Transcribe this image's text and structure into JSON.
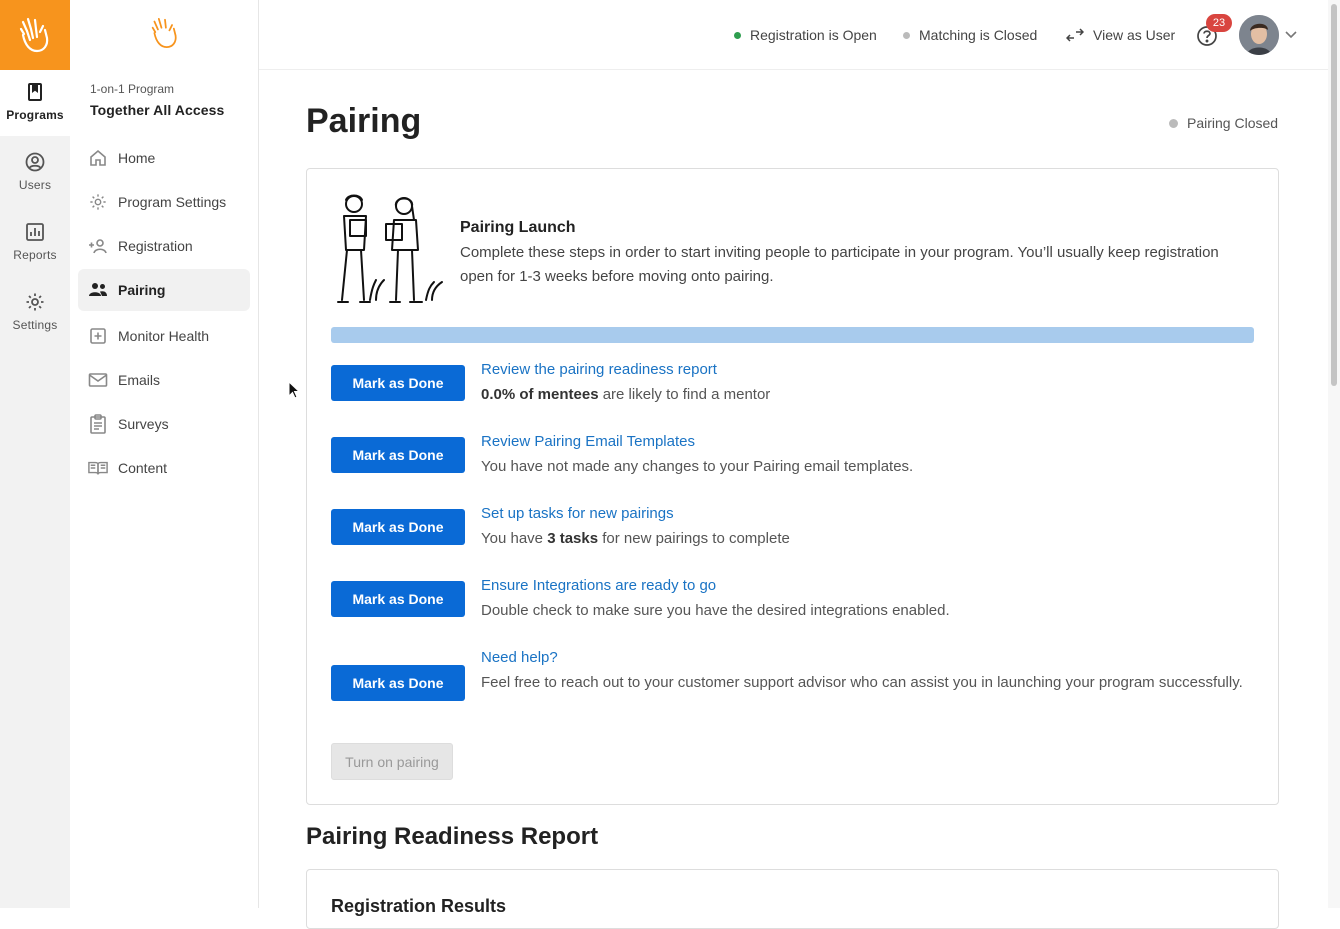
{
  "rail": {
    "items": [
      {
        "label": "Programs",
        "icon": "bookmark-icon",
        "active": true
      },
      {
        "label": "Users",
        "icon": "user-circle-icon"
      },
      {
        "label": "Reports",
        "icon": "bar-chart-icon"
      },
      {
        "label": "Settings",
        "icon": "gear-icon"
      }
    ],
    "brand_color": "#f7941d"
  },
  "sidebar": {
    "program_type": "1-on-1 Program",
    "program_name": "Together All Access",
    "items": [
      {
        "label": "Home",
        "icon": "home-icon"
      },
      {
        "label": "Program Settings",
        "icon": "gear-icon"
      },
      {
        "label": "Registration",
        "icon": "add-user-icon"
      },
      {
        "label": "Pairing",
        "icon": "people-icon",
        "active": true
      },
      {
        "label": "Monitor Health",
        "icon": "plus-square-icon"
      },
      {
        "label": "Emails",
        "icon": "envelope-icon"
      },
      {
        "label": "Surveys",
        "icon": "clipboard-icon"
      },
      {
        "label": "Content",
        "icon": "book-icon"
      }
    ]
  },
  "topbar": {
    "registration_status": "Registration is Open",
    "matching_status": "Matching is Closed",
    "view_as_user": "View as User",
    "notification_count": "23",
    "colors": {
      "open": "#2e9e4f",
      "closed": "#bbbbbb"
    }
  },
  "main": {
    "title": "Pairing",
    "pairing_status": "Pairing Closed",
    "launch": {
      "title": "Pairing Launch",
      "description": "Complete these steps in order to start inviting people to participate in your program. You’ll usually keep registration open for 1-3 weeks before moving onto pairing.",
      "progress": 0
    },
    "mark_done_label": "Mark as Done",
    "steps": [
      {
        "link": "Review the pairing readiness report",
        "desc_bold": "0.0% of mentees",
        "desc_rest": " are likely to find a mentor"
      },
      {
        "link": "Review Pairing Email Templates",
        "desc": "You have not made any changes to your Pairing email templates."
      },
      {
        "link": "Set up tasks for new pairings",
        "desc_pre": "You have ",
        "desc_bold": "3 tasks",
        "desc_rest": " for new pairings to complete"
      },
      {
        "link": "Ensure Integrations are ready to go",
        "desc": "Double check to make sure you have the desired integrations enabled."
      },
      {
        "link": "Need help?",
        "desc": "Feel free to reach out to your customer support advisor who can assist you in launching your program successfully."
      }
    ],
    "turn_on_label": "Turn on pairing",
    "report_heading": "Pairing Readiness Report",
    "report_card_title": "Registration Results"
  }
}
